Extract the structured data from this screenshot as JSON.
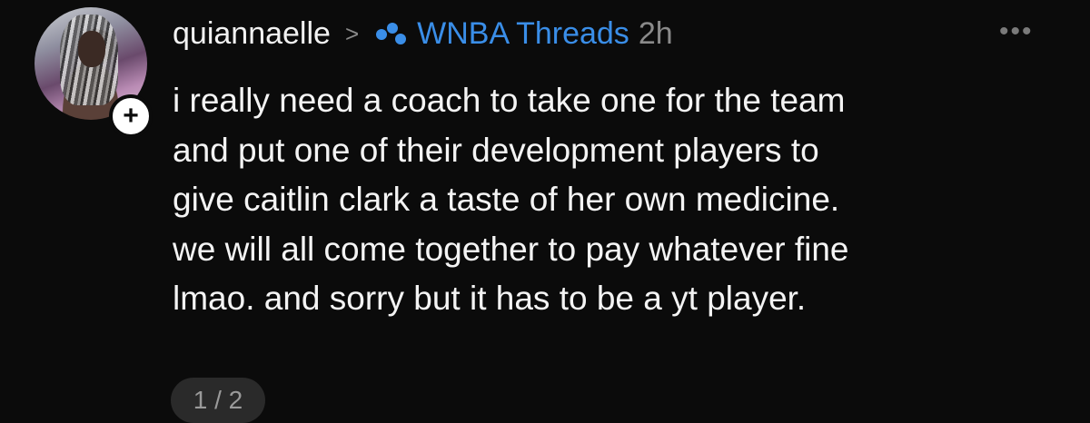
{
  "post": {
    "username": "quiannaelle",
    "breadcrumb_separator": ">",
    "community": "WNBA Threads",
    "timestamp": "2h",
    "more_menu": "•••",
    "follow_symbol": "+",
    "body_lines": [
      "i really need a coach to take one for the team",
      "and put one of their development players to",
      "give caitlin clark a taste of her own medicine.",
      "we will all come together to pay whatever fine",
      "lmao. and sorry but it has to be a yt player."
    ],
    "page_indicator": "1 / 2"
  },
  "colors": {
    "background": "#0b0b0b",
    "text": "#f4f4f4",
    "community_link": "#3a8ee8",
    "muted": "#8a8a8a",
    "pager_bg": "#2a2a2a"
  },
  "icons": {
    "avatar": "profile-photo",
    "follow": "plus-icon",
    "community": "community-dots-icon",
    "menu": "more-horizontal-icon"
  }
}
